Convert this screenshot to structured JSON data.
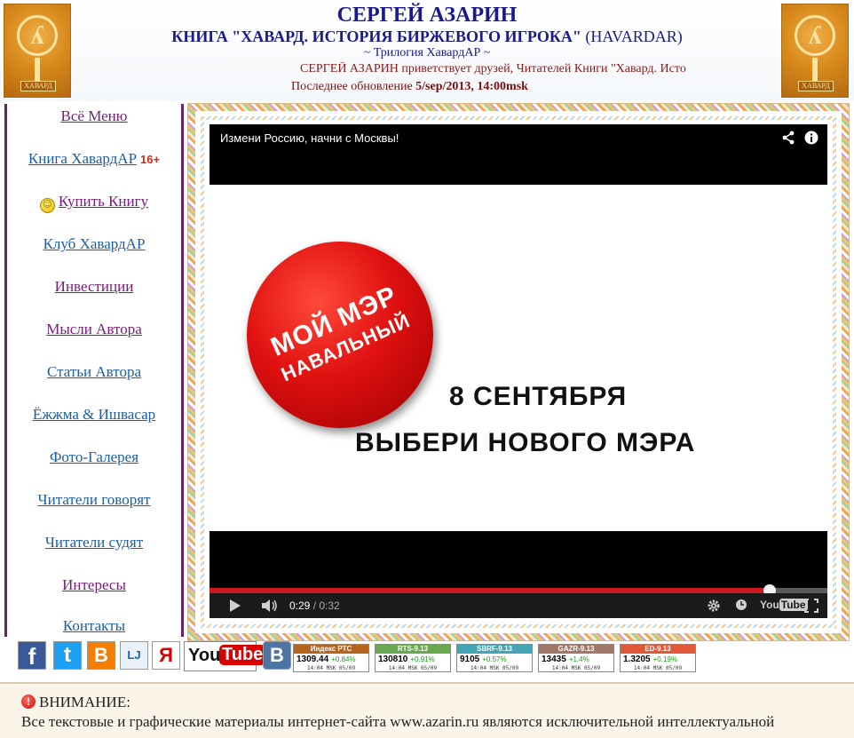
{
  "header": {
    "title": "СЕРГЕЙ АЗАРИН",
    "subtitle_bold": "КНИГА \"ХАВАРД. ИСТОРИЯ БИРЖЕВОГО ИГРОКА\"",
    "subtitle_tail": "(HAVARDAR)",
    "trilogy": "~ Трилогия ХавардАР ~",
    "marquee": "СЕРГЕЙ АЗАРИН приветствует друзей, Читателей Книги \"Хавард. Исто",
    "update_label": "Последнее обновление",
    "update_value": "5/sep/2013, 14:00msk",
    "logo_plate": "ХАВАРД"
  },
  "sidebar": {
    "items": [
      {
        "label": "Всё Меню"
      },
      {
        "label": "Книга ХавардАР",
        "badge": "16+"
      },
      {
        "label": "Купить Книгу"
      },
      {
        "label": "Клуб ХавардАР"
      },
      {
        "label": "Инвестиции"
      },
      {
        "label": "Мысли Автора"
      },
      {
        "label": "Статьи Автора"
      },
      {
        "label": "Ёжжма & Ишвасар"
      },
      {
        "label": "Фото-Галерея"
      },
      {
        "label": "Читатели говорят"
      },
      {
        "label": "Читатели судят"
      },
      {
        "label": "Интересы"
      },
      {
        "label": "Контакты"
      }
    ]
  },
  "video": {
    "title": "Измени Россию, начни с Москвы!",
    "badge_line1": "МОЙ МЭР",
    "badge_line2": "НАВАЛЬНЫЙ",
    "date_text": "8 СЕНТЯБРЯ",
    "cta_text": "ВЫБЕРИ НОВОГО МЭРА",
    "current_time": "0:29",
    "duration": "/ 0:32",
    "progress": 0.906,
    "yt_you": "You",
    "yt_tube": "Tube"
  },
  "social": {
    "facebook": "f",
    "twitter": "t",
    "blogger": "B",
    "livejournal": "LJ",
    "yandex": "Я",
    "youtube_you": "You",
    "youtube_tube": "Tube",
    "vk": "B"
  },
  "tickers": [
    {
      "name": "Индекс РТС",
      "value": "1309.44",
      "change": "+0.84%",
      "time": "14:04 MSK 05/09",
      "color": "#b5651d"
    },
    {
      "name": "RTS-9.13",
      "value": "130810",
      "change": "+0.91%",
      "time": "14:04 MSK 05/09",
      "color": "#6aa84f"
    },
    {
      "name": "SBRF-9.13",
      "value": "9105",
      "change": "+0.57%",
      "time": "14:04 MSK 05/09",
      "color": "#45a5b5"
    },
    {
      "name": "GAZR-9.13",
      "value": "13435",
      "change": "+1.4%",
      "time": "14:04 MSK 05/09",
      "color": "#a0786a"
    },
    {
      "name": "ED-9.13",
      "value": "1.3205",
      "change": "+0.19%",
      "time": "14:04 MSK 05/09",
      "color": "#e05a3a"
    }
  ],
  "notice": {
    "title": "ВНИМАНИЕ:",
    "text": "Все текстовые и графические материалы интернет-сайта www.azarin.ru являются исключительной интеллектуальной"
  }
}
